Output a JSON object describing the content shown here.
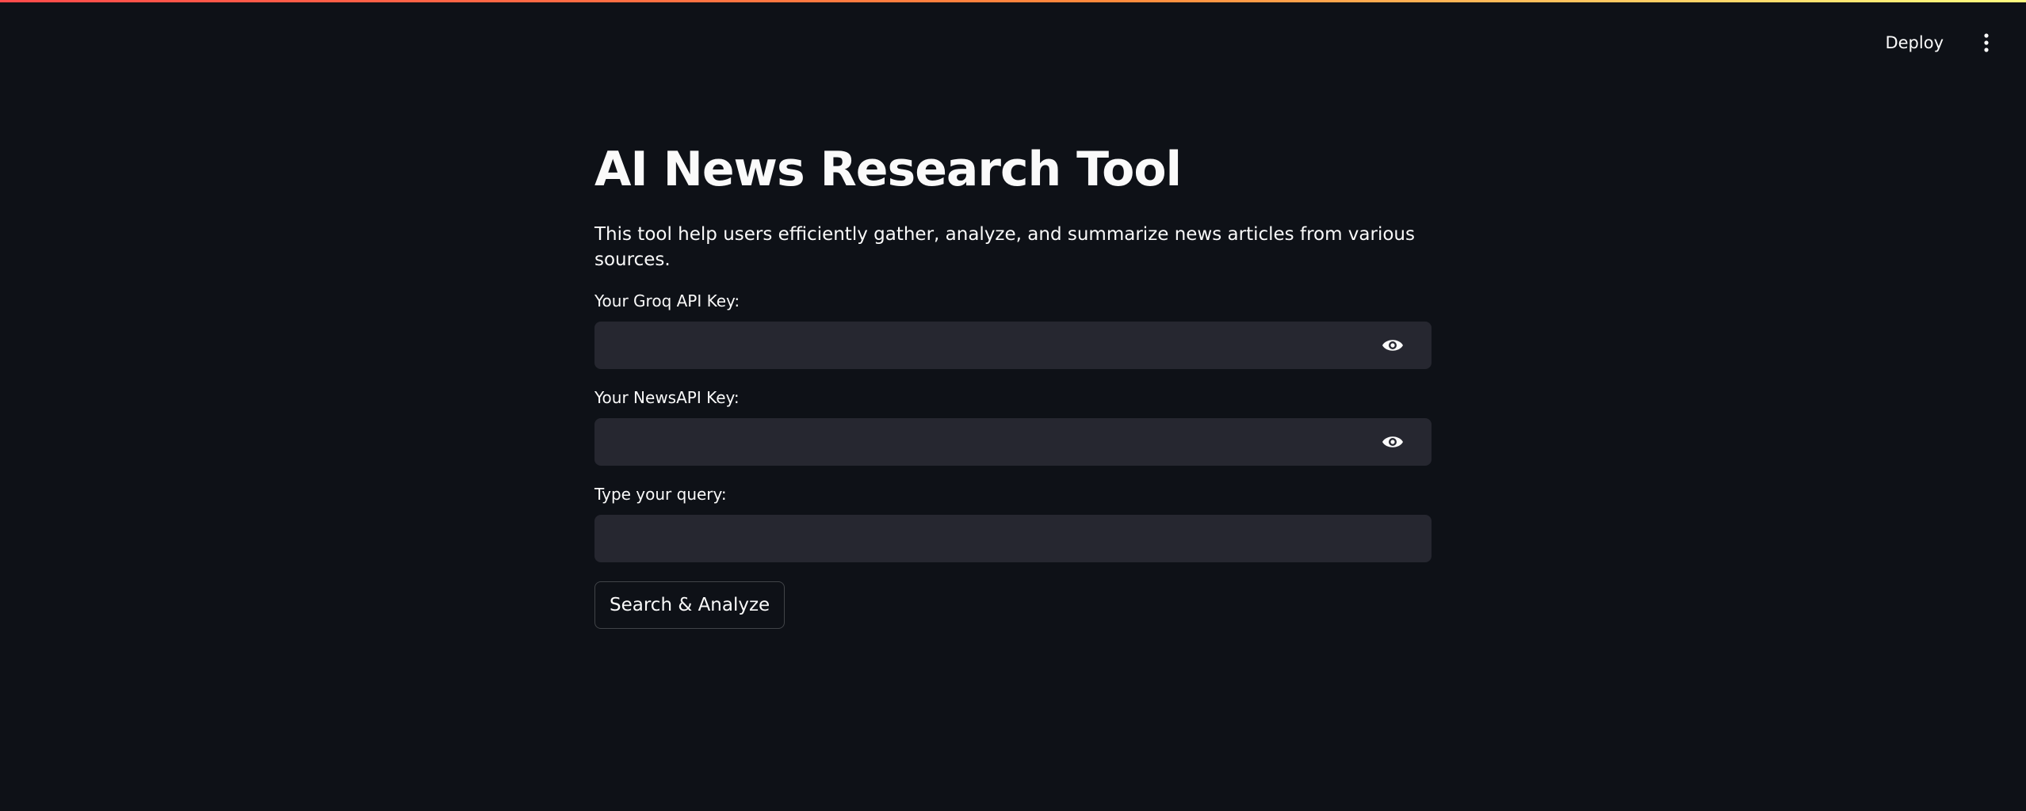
{
  "header": {
    "deploy_label": "Deploy",
    "menu_icon": "more-vertical-icon"
  },
  "main": {
    "title": "AI News Research Tool",
    "description": "This tool help users efficiently gather, analyze, and summarize news articles from various sources.",
    "fields": [
      {
        "label": "Your Groq API Key:",
        "value": "",
        "placeholder": "",
        "type": "password",
        "icon": "eye-icon"
      },
      {
        "label": "Your NewsAPI Key:",
        "value": "",
        "placeholder": "",
        "type": "password",
        "icon": "eye-icon"
      },
      {
        "label": "Type your query:",
        "value": "",
        "placeholder": "",
        "type": "text"
      }
    ],
    "submit_label": "Search & Analyze"
  },
  "colors": {
    "background": "#0e1117",
    "input_background": "#262730",
    "text": "#fafafa",
    "accent_gradient_start": "#ff4b4b",
    "accent_gradient_end": "#fffd80"
  }
}
